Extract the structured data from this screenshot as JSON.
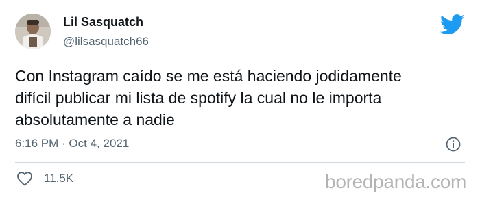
{
  "tweet": {
    "author_name": "Lil Sasquatch",
    "author_handle": "@lilsasquatch66",
    "text_lines": [
      "Con Instagram caído se me está haciendo jodidamente",
      "difícil publicar mi lista de spotify la cual no le importa",
      "absolutamente a nadie"
    ],
    "timestamp": "6:16 PM · Oct 4, 2021",
    "like_count": "11.5K"
  },
  "icons": {
    "platform": "twitter-bird-icon",
    "info": "info-icon",
    "like": "heart-icon"
  },
  "colors": {
    "twitter_blue": "#1d9bf0",
    "secondary_text": "#536471",
    "primary_text": "#0f1419"
  },
  "watermark": "boredpanda.com"
}
